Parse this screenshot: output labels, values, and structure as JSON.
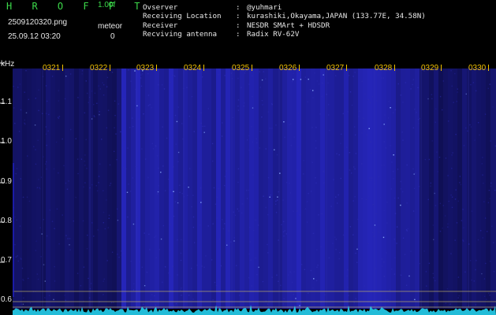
{
  "header": {
    "brand": "H R O F F T",
    "version": "1.00f",
    "filename": "2509120320.png",
    "datetime": "25.09.12 03:20",
    "meteor_label": "meteor",
    "meteor_count": "0"
  },
  "info": [
    {
      "key": "Ovserver",
      "value": "@yuhmari"
    },
    {
      "key": "Receiving Location",
      "value": "kurashiki,Okayama,JAPAN (133.77E, 34.58N)"
    },
    {
      "key": "Receiver",
      "value": "NESDR SMArt + HDSDR"
    },
    {
      "key": "Recviving antenna",
      "value": "Radix RV-62V"
    }
  ],
  "spectrogram": {
    "unit_label": "kHz",
    "time_ticks": [
      "0321",
      "0322",
      "0323",
      "0324",
      "0325",
      "0326",
      "0327",
      "0328",
      "0329",
      "0330"
    ],
    "freq_ticks": [
      "1.1",
      "1.0",
      "0.9",
      "0.8",
      "0.7",
      "0.6"
    ],
    "colors": {
      "background": "#000000",
      "noise_dark": "#0b0b3a",
      "noise_bright": "#2a2ab0",
      "tick": "#f2c200",
      "reference_line": "#c8b96a",
      "baseline": "#26d0f0"
    }
  }
}
